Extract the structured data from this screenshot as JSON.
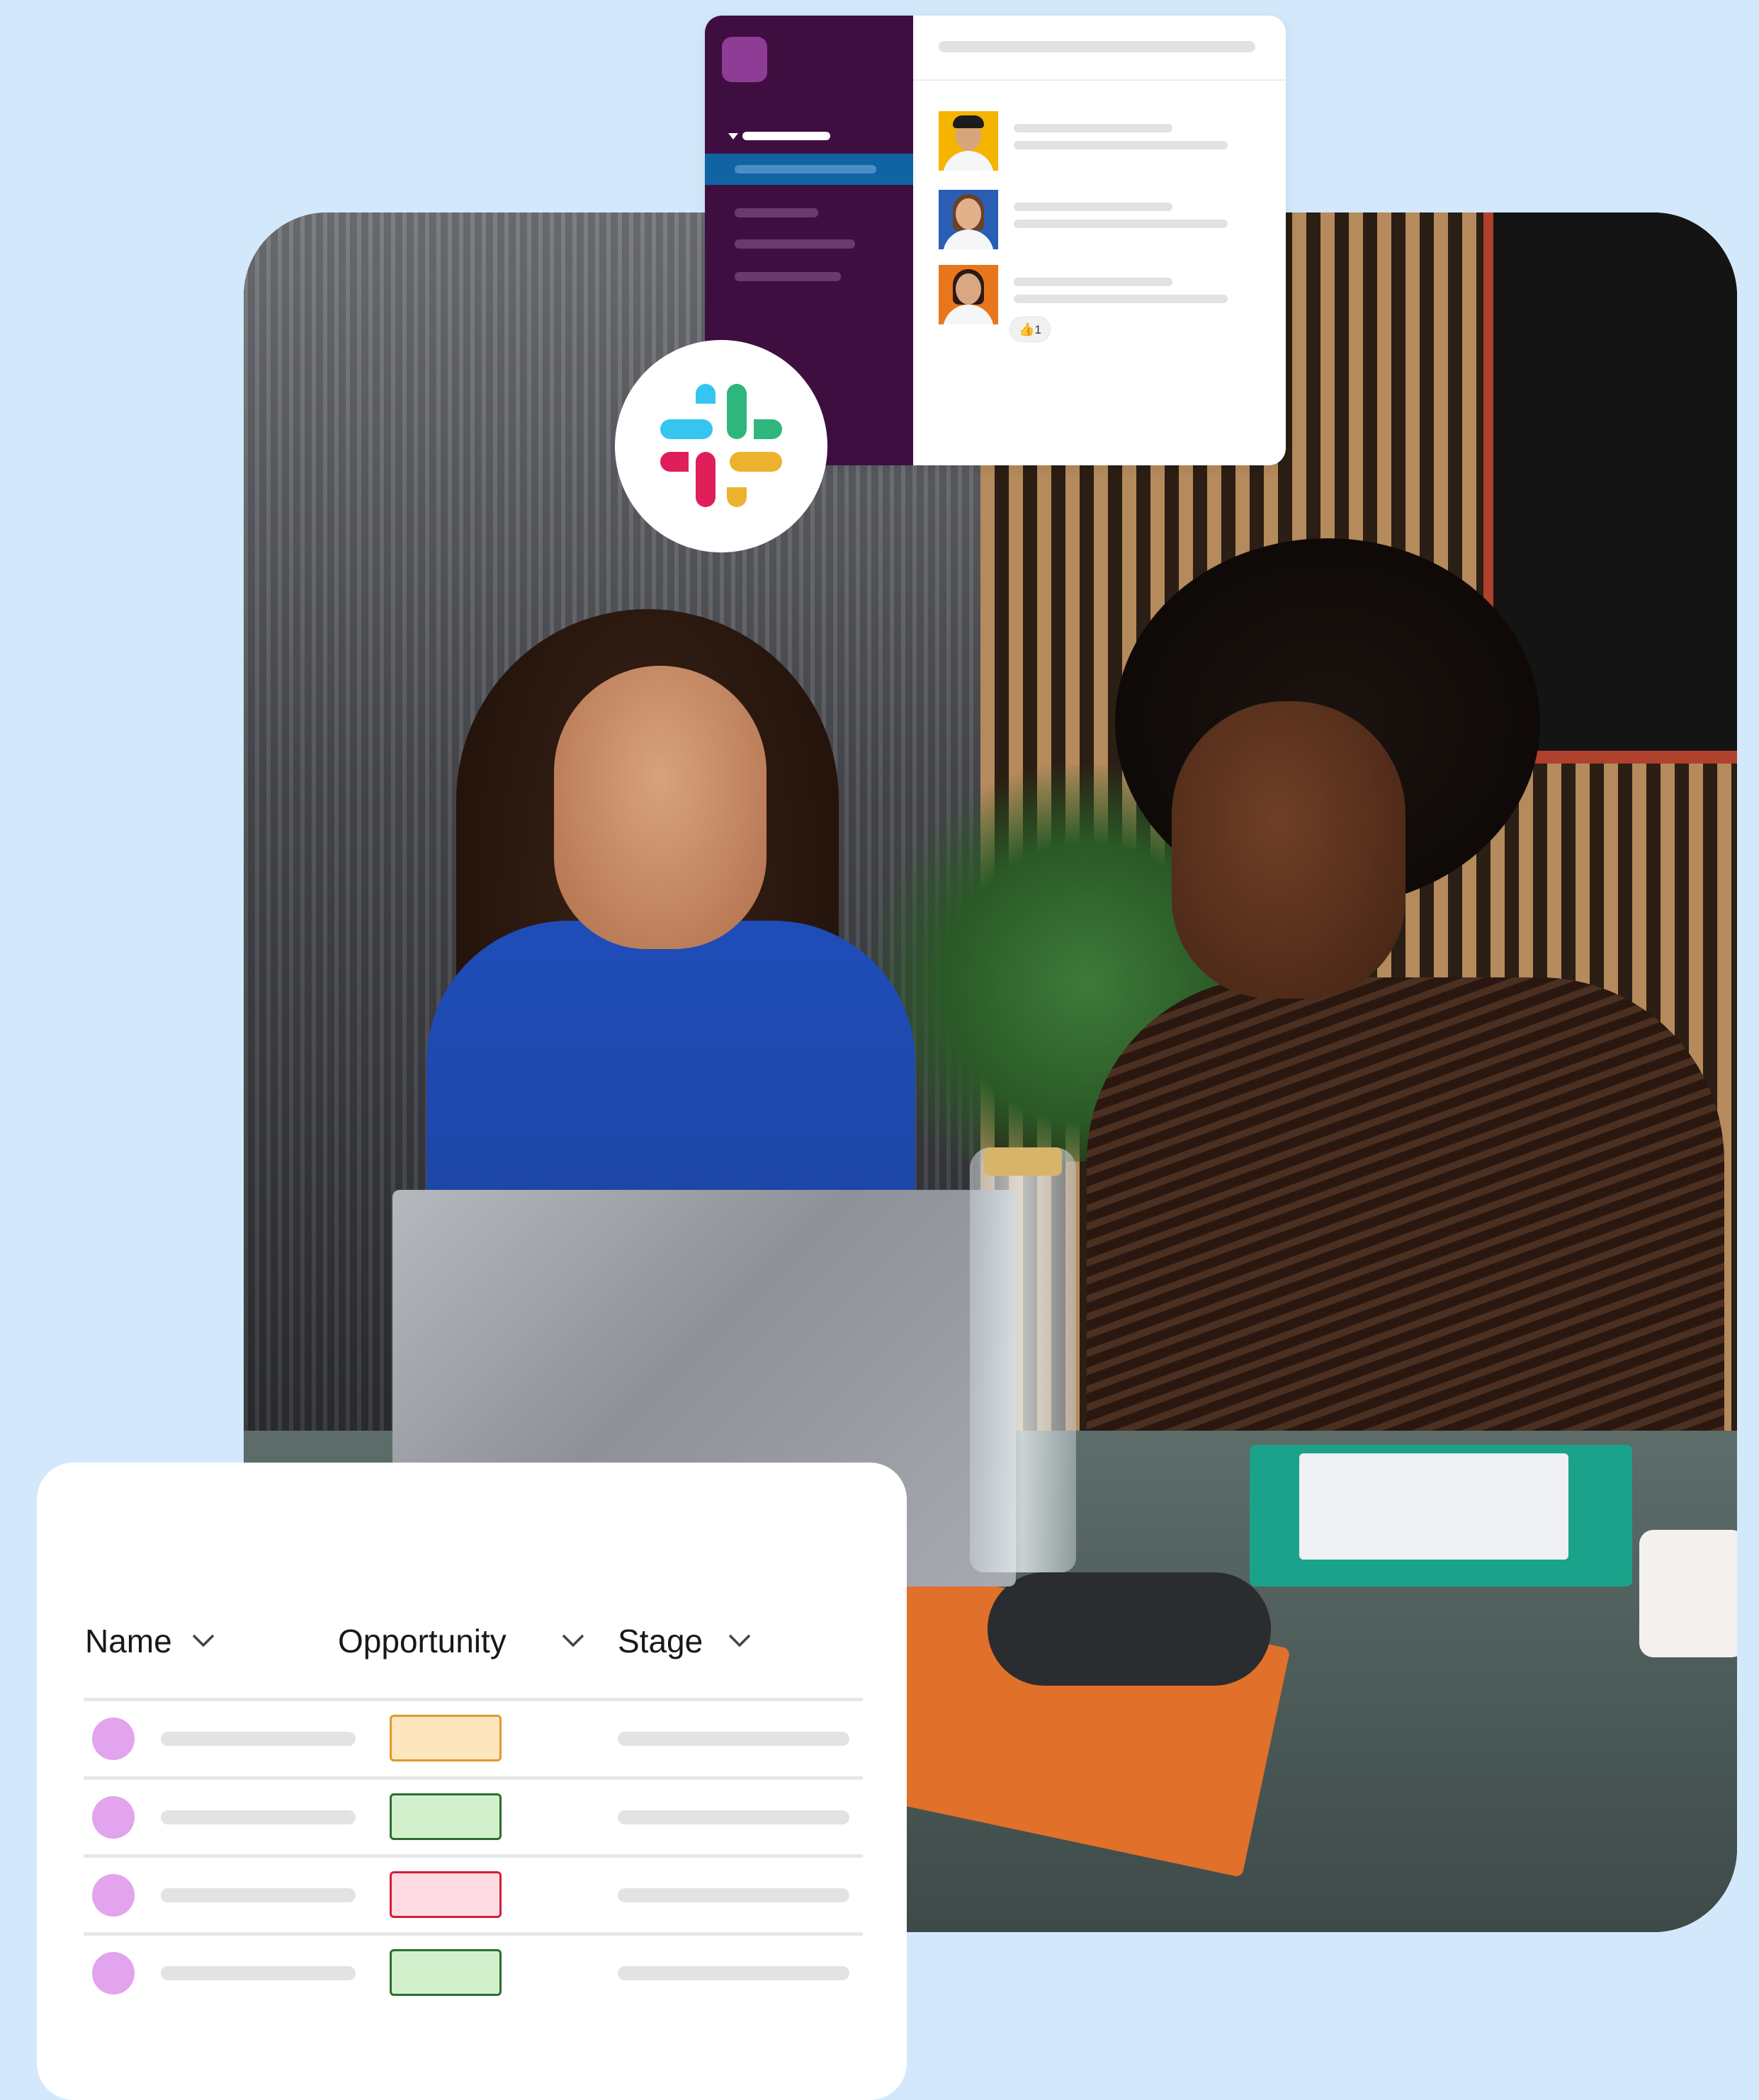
{
  "slack_card": {
    "messages": [
      {
        "avatar_name": "man-avatar"
      },
      {
        "avatar_name": "woman-avatar"
      },
      {
        "avatar_name": "woman-glasses-avatar"
      }
    ],
    "reaction": {
      "emoji": "thumbs-up",
      "count": "1"
    }
  },
  "table": {
    "columns": [
      {
        "label": "Name"
      },
      {
        "label": "Opportunity"
      },
      {
        "label": "Stage"
      }
    ],
    "rows": [
      {
        "opportunity_color": "#fde6bd",
        "opportunity_border": "#e09a2a"
      },
      {
        "opportunity_color": "#d3f0cd",
        "opportunity_border": "#2c6e2f"
      },
      {
        "opportunity_color": "#ffdbe3",
        "opportunity_border": "#d31f36"
      },
      {
        "opportunity_color": "#d3f0cd",
        "opportunity_border": "#2c6e2f"
      }
    ]
  },
  "colors": {
    "background": "#d3e9fb",
    "slack_sidebar": "#3f0e40",
    "slack_selected": "#1164a3",
    "avatar_pink": "#e2a4ec"
  }
}
